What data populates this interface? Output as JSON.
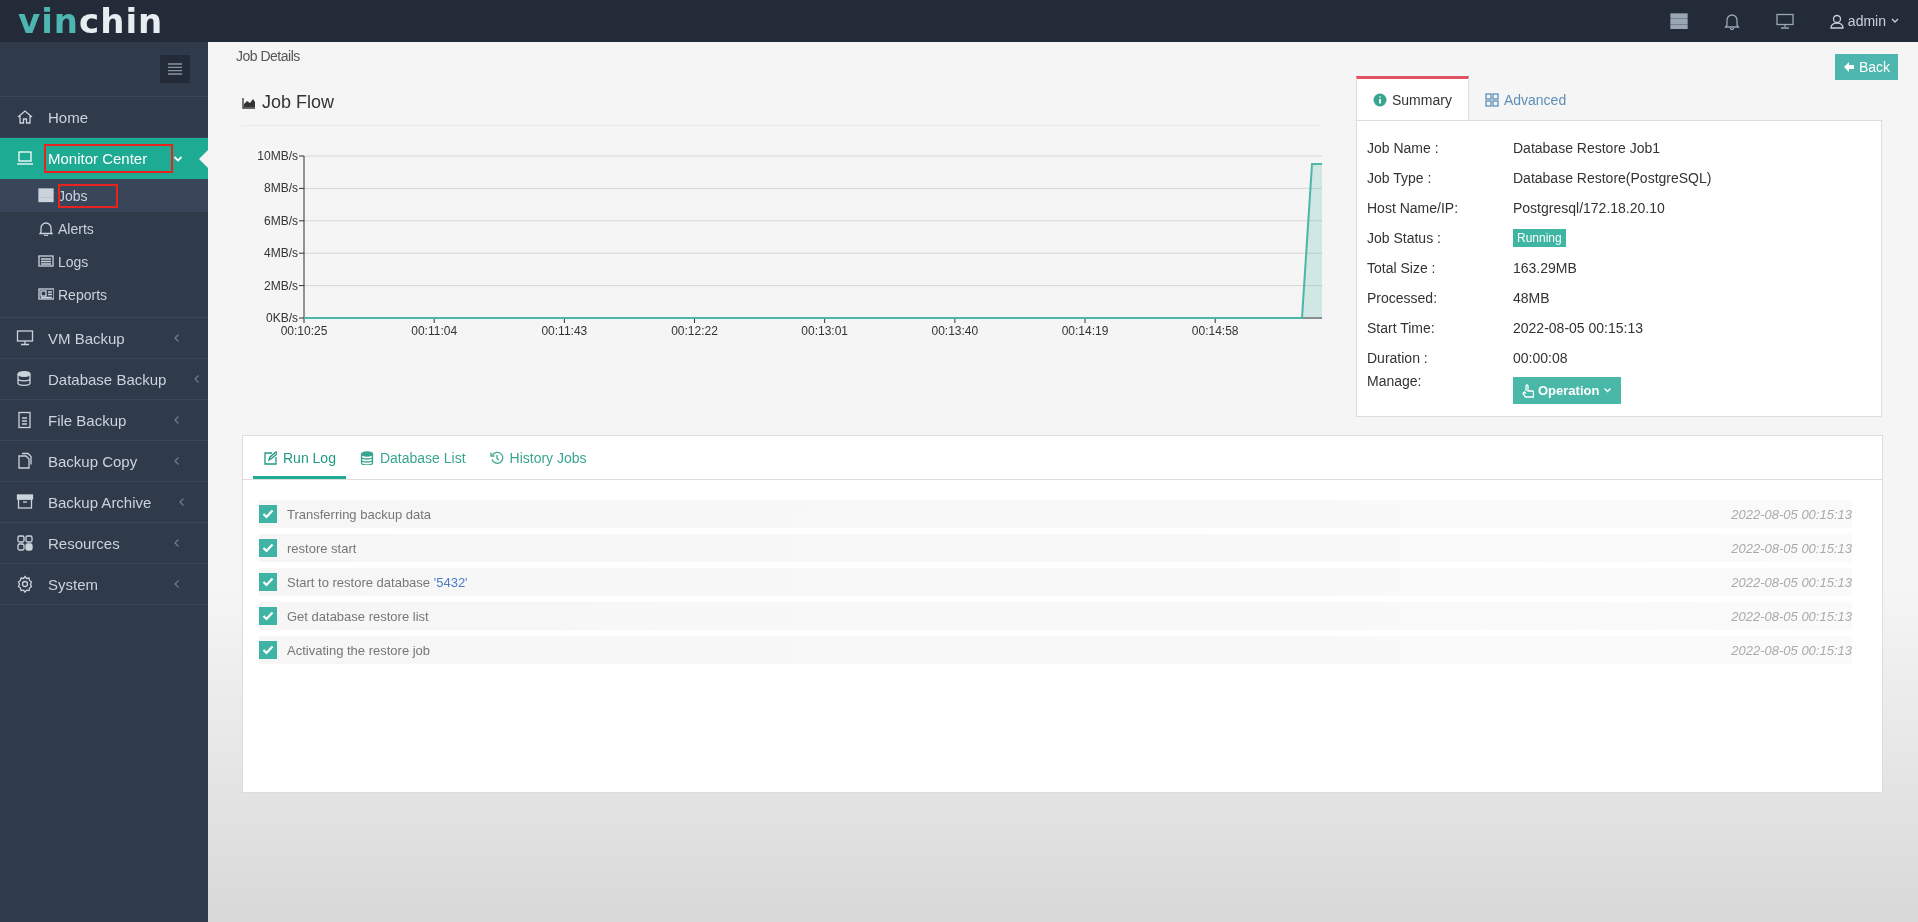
{
  "topbar": {
    "logo_left": "vin",
    "logo_right": "chin",
    "user": "admin"
  },
  "sidebar": {
    "items": [
      {
        "label": "Home",
        "expanded": false,
        "selected": false,
        "highlighted": false,
        "has_arrow": false
      },
      {
        "label": "Monitor Center",
        "expanded": true,
        "selected": true,
        "highlighted": true,
        "has_arrow": true,
        "children": [
          {
            "label": "Jobs",
            "selected": true,
            "highlighted": true
          },
          {
            "label": "Alerts",
            "selected": false,
            "highlighted": false
          },
          {
            "label": "Logs",
            "selected": false,
            "highlighted": false
          },
          {
            "label": "Reports",
            "selected": false,
            "highlighted": false
          }
        ]
      },
      {
        "label": "VM Backup",
        "expanded": false,
        "selected": false,
        "highlighted": false,
        "has_arrow": true
      },
      {
        "label": "Database Backup",
        "expanded": false,
        "selected": false,
        "highlighted": false,
        "has_arrow": true
      },
      {
        "label": "File Backup",
        "expanded": false,
        "selected": false,
        "highlighted": false,
        "has_arrow": true
      },
      {
        "label": "Backup Copy",
        "expanded": false,
        "selected": false,
        "highlighted": false,
        "has_arrow": true
      },
      {
        "label": "Backup Archive",
        "expanded": false,
        "selected": false,
        "highlighted": false,
        "has_arrow": true
      },
      {
        "label": "Resources",
        "expanded": false,
        "selected": false,
        "highlighted": false,
        "has_arrow": true
      },
      {
        "label": "System",
        "expanded": false,
        "selected": false,
        "highlighted": false,
        "has_arrow": true
      }
    ]
  },
  "page": {
    "title": "Job Details",
    "back_button": "Back"
  },
  "job_flow": {
    "title": "Job Flow",
    "chart_data": {
      "type": "area",
      "x": [
        625,
        924,
        927,
        930
      ],
      "series": [
        {
          "color": "#4db6a6",
          "values": [
            0,
            0,
            9.5,
            9.5
          ]
        }
      ],
      "grid": true,
      "xlim": [
        625,
        930
      ],
      "ylim": [
        0,
        10
      ],
      "xticks": [
        {
          "value": 625,
          "label": "00:10:25"
        },
        {
          "value": 664,
          "label": "00:11:04"
        },
        {
          "value": 703,
          "label": "00:11:43"
        },
        {
          "value": 742,
          "label": "00:12:22"
        },
        {
          "value": 781,
          "label": "00:13:01"
        },
        {
          "value": 820,
          "label": "00:13:40"
        },
        {
          "value": 859,
          "label": "00:14:19"
        },
        {
          "value": 898,
          "label": "00:14:58"
        }
      ],
      "yticks": [
        {
          "value": 0,
          "label": "0KB/s"
        },
        {
          "value": 2,
          "label": "2MB/s"
        },
        {
          "value": 4,
          "label": "4MB/s"
        },
        {
          "value": 6,
          "label": "6MB/s"
        },
        {
          "value": 8,
          "label": "8MB/s"
        },
        {
          "value": 10,
          "label": "10MB/s"
        }
      ]
    }
  },
  "summary": {
    "tabs": [
      {
        "label": "Summary",
        "selected": true
      },
      {
        "label": "Advanced",
        "selected": false
      }
    ],
    "rows": [
      {
        "kind": "text",
        "label": "Job Name :",
        "value": "Database Restore Job1"
      },
      {
        "kind": "text",
        "label": "Job Type :",
        "value": "Database Restore(PostgreSQL)"
      },
      {
        "kind": "text",
        "label": "Host Name/IP:",
        "value": "Postgresql/172.18.20.10"
      },
      {
        "kind": "status",
        "label": "Job Status :",
        "value": "Running"
      },
      {
        "kind": "text",
        "label": "Total Size :",
        "value": "163.29MB"
      },
      {
        "kind": "text",
        "label": "Processed:",
        "value": "48MB"
      },
      {
        "kind": "text",
        "label": "Start Time:",
        "value": "2022-08-05 00:15:13"
      },
      {
        "kind": "text",
        "label": "Duration :",
        "value": "00:00:08"
      },
      {
        "kind": "button",
        "label": "Manage:",
        "value": "Operation"
      }
    ]
  },
  "log_panel": {
    "tabs": [
      {
        "label": "Run Log",
        "selected": true
      },
      {
        "label": "Database List",
        "selected": false
      },
      {
        "label": "History Jobs",
        "selected": false
      }
    ],
    "entries": [
      {
        "text": "Transferring backup data",
        "time": "2022-08-05 00:15:13",
        "done": true
      },
      {
        "text": "restore start",
        "time": "2022-08-05 00:15:13",
        "done": true
      },
      {
        "text": "Start to restore database ",
        "quoted": "'5432'",
        "time": "2022-08-05 00:15:13",
        "done": true
      },
      {
        "text": "Get database restore list",
        "time": "2022-08-05 00:15:13",
        "done": true
      },
      {
        "text": "Activating the restore job",
        "time": "2022-08-05 00:15:13",
        "done": true
      }
    ]
  }
}
